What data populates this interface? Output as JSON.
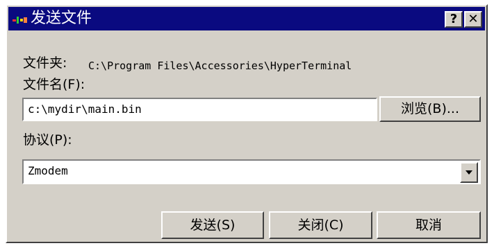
{
  "window": {
    "title": "发送文件",
    "help_glyph": "?",
    "close_glyph": "✕",
    "titlebar_color": "#0a0a80",
    "face_color": "#d4d0c8"
  },
  "folder": {
    "label": "文件夹:",
    "path": "C:\\Program Files\\Accessories\\HyperTerminal"
  },
  "filename": {
    "label": "文件名(F):",
    "value": "c:\\mydir\\main.bin",
    "browse_label": "浏览(B)..."
  },
  "protocol": {
    "label": "协议(P):",
    "selected": "Zmodem"
  },
  "buttons": {
    "send": "发送(S)",
    "close": "关闭(C)",
    "cancel": "取消"
  },
  "icons": [
    "app-icon",
    "help-icon",
    "close-icon",
    "dropdown-arrow-icon"
  ]
}
